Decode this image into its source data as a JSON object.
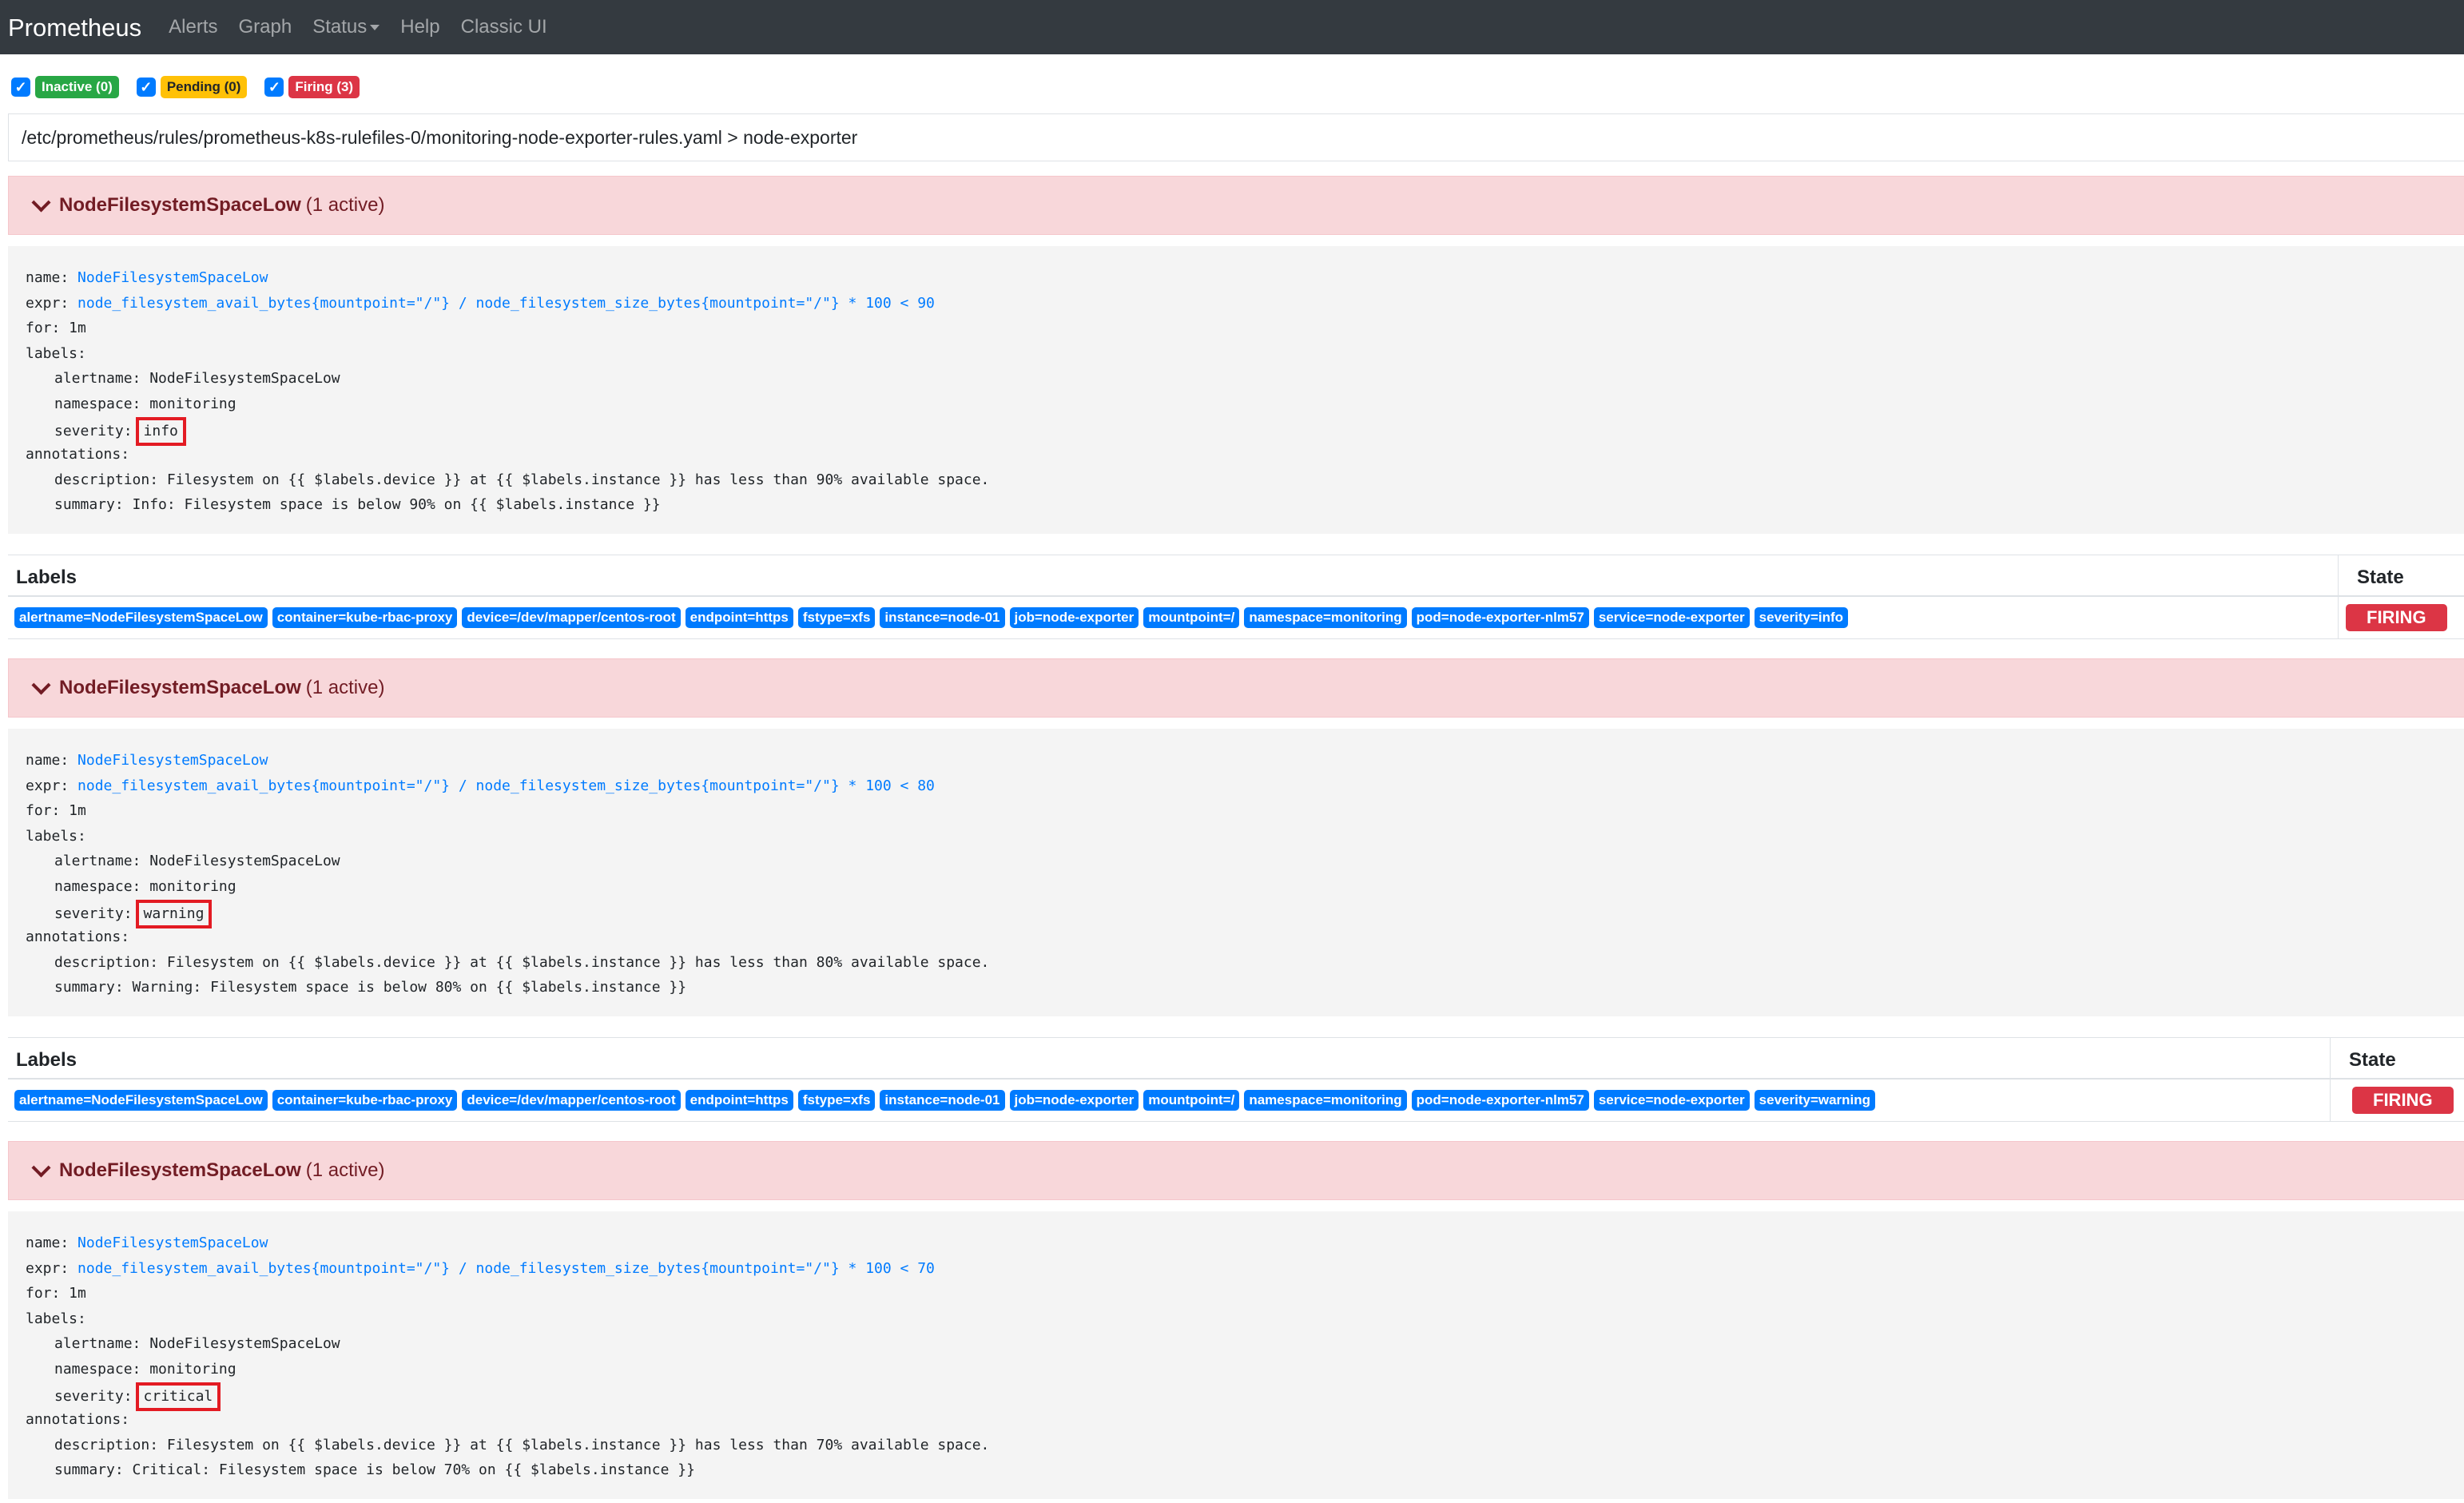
{
  "navbar": {
    "brand": "Prometheus",
    "items": [
      "Alerts",
      "Graph",
      "Status",
      "Help",
      "Classic UI"
    ]
  },
  "filters": [
    {
      "label": "Inactive (0)",
      "checked": true,
      "color": "#28a745"
    },
    {
      "label": "Pending (0)",
      "checked": true,
      "color": "#ffc107"
    },
    {
      "label": "Firing (3)",
      "checked": true,
      "color": "#dc3545"
    }
  ],
  "filepath": "/etc/prometheus/rules/prometheus-k8s-rulefiles-0/monitoring-node-exporter-rules.yaml > node-exporter",
  "table_headers": {
    "labels": "Labels",
    "state": "State"
  },
  "rules": [
    {
      "title": "NodeFilesystemSpaceLow",
      "count": "(1 active)",
      "code": {
        "name_key": "name:",
        "name_val": "NodeFilesystemSpaceLow",
        "expr_key": "expr:",
        "expr_val": "node_filesystem_avail_bytes{mountpoint=\"/\"} / node_filesystem_size_bytes{mountpoint=\"/\"} * 100 < 90",
        "for": "for: 1m",
        "labels_key": "labels:",
        "alertname": "alertname: NodeFilesystemSpaceLow",
        "namespace": "namespace: monitoring",
        "severity_key": "severity:",
        "severity_val": "info",
        "annotations_key": "annotations:",
        "description": "description: Filesystem on {{ $labels.device }} at {{ $labels.instance }} has less than 90% available space.",
        "summary": "summary: Info: Filesystem space is below 90% on {{ $labels.instance }}"
      },
      "alert_labels": [
        "alertname=NodeFilesystemSpaceLow",
        "container=kube-rbac-proxy",
        "device=/dev/mapper/centos-root",
        "endpoint=https",
        "fstype=xfs",
        "instance=node-01",
        "job=node-exporter",
        "mountpoint=/",
        "namespace=monitoring",
        "pod=node-exporter-nlm57",
        "service=node-exporter",
        "severity=info"
      ],
      "state": "FIRING"
    },
    {
      "title": "NodeFilesystemSpaceLow",
      "count": "(1 active)",
      "code": {
        "name_key": "name:",
        "name_val": "NodeFilesystemSpaceLow",
        "expr_key": "expr:",
        "expr_val": "node_filesystem_avail_bytes{mountpoint=\"/\"} / node_filesystem_size_bytes{mountpoint=\"/\"} * 100 < 80",
        "for": "for: 1m",
        "labels_key": "labels:",
        "alertname": "alertname: NodeFilesystemSpaceLow",
        "namespace": "namespace: monitoring",
        "severity_key": "severity:",
        "severity_val": "warning",
        "annotations_key": "annotations:",
        "description": "description: Filesystem on {{ $labels.device }} at {{ $labels.instance }} has less than 80% available space.",
        "summary": "summary: Warning: Filesystem space is below 80% on {{ $labels.instance }}"
      },
      "alert_labels": [
        "alertname=NodeFilesystemSpaceLow",
        "container=kube-rbac-proxy",
        "device=/dev/mapper/centos-root",
        "endpoint=https",
        "fstype=xfs",
        "instance=node-01",
        "job=node-exporter",
        "mountpoint=/",
        "namespace=monitoring",
        "pod=node-exporter-nlm57",
        "service=node-exporter",
        "severity=warning"
      ],
      "state": "FIRING"
    },
    {
      "title": "NodeFilesystemSpaceLow",
      "count": "(1 active)",
      "code": {
        "name_key": "name:",
        "name_val": "NodeFilesystemSpaceLow",
        "expr_key": "expr:",
        "expr_val": "node_filesystem_avail_bytes{mountpoint=\"/\"} / node_filesystem_size_bytes{mountpoint=\"/\"} * 100 < 70",
        "for": "for: 1m",
        "labels_key": "labels:",
        "alertname": "alertname: NodeFilesystemSpaceLow",
        "namespace": "namespace: monitoring",
        "severity_key": "severity:",
        "severity_val": "critical",
        "annotations_key": "annotations:",
        "description": "description: Filesystem on {{ $labels.device }} at {{ $labels.instance }} has less than 70% available space.",
        "summary": "summary: Critical: Filesystem space is below 70% on {{ $labels.instance }}"
      },
      "alert_labels": [],
      "state": ""
    }
  ]
}
